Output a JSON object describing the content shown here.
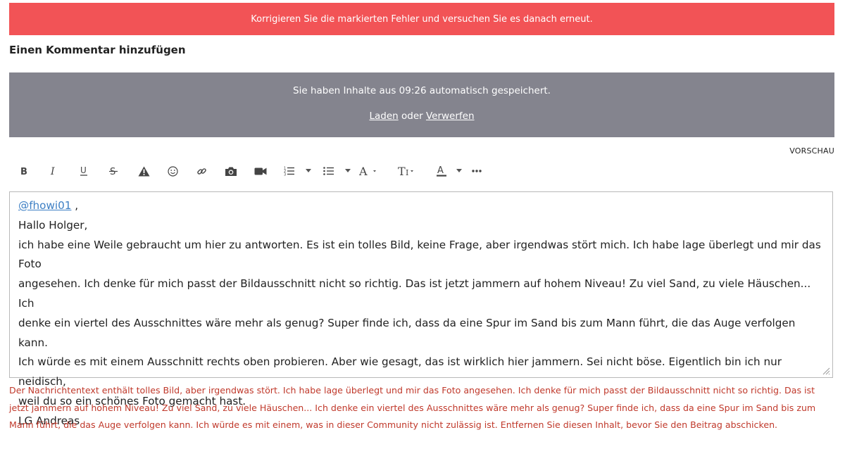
{
  "error_banner": {
    "text": "Korrigieren Sie die markierten Fehler und versuchen Sie es danach erneut."
  },
  "section_title": "Einen Kommentar hinzufügen",
  "autosave": {
    "message": "Sie haben Inhalte aus 09:26 automatisch gespeichert.",
    "load_label": "Laden",
    "or_label": "oder",
    "discard_label": "Verwerfen"
  },
  "preview_label": "VORSCHAU",
  "toolbar": {
    "icons": [
      "bold-icon",
      "italic-icon",
      "underline-icon",
      "strikethrough-icon",
      "warning-icon",
      "emoji-icon",
      "link-icon",
      "camera-icon",
      "video-icon",
      "numbered-list-icon",
      "bulleted-list-icon",
      "font-icon",
      "text-size-icon",
      "text-color-icon",
      "more-icon"
    ]
  },
  "editor": {
    "mention": "@fhowi01",
    "mention_suffix": " ,",
    "lines": [
      "Hallo Holger,",
      "ich habe eine Weile gebraucht um hier zu antworten. Es ist ein tolles Bild, keine Frage, aber irgendwas stört mich. Ich habe lage überlegt und mir das Foto",
      "angesehen. Ich denke für mich passt der Bildausschnitt nicht so richtig. Das ist jetzt jammern auf hohem Niveau! Zu viel Sand, zu viele Häuschen... Ich",
      "denke ein viertel des Ausschnittes wäre mehr als genug? Super finde ich, dass da eine Spur im Sand bis zum Mann führt, die das Auge verfolgen kann.",
      "Ich würde es mit einem Ausschnitt rechts oben probieren. Aber wie gesagt, das ist wirklich hier jammern. Sei nicht böse. Eigentlich bin ich nur neidisch,",
      "weil du so ein schönes Foto gemacht hast.",
      "LG Andreas"
    ]
  },
  "validation_error": {
    "lines": [
      "Der Nachrichtentext enthält tolles Bild, aber irgendwas stört. Ich habe lage überlegt und mir das Foto angesehen. Ich denke für mich passt der Bildausschnitt nicht so richtig. Das ist",
      "jetzt jammern auf hohem Niveau! Zu viel Sand, zu viele Häuschen... Ich denke ein viertel des Ausschnittes wäre mehr als genug? Super finde ich, dass da eine Spur im Sand bis zum",
      "Mann führt, die das Auge verfolgen kann. Ich würde es mit einem, was in dieser Community nicht zulässig ist. Entfernen Sie diesen Inhalt, bevor Sie den Beitrag abschicken."
    ]
  },
  "colors": {
    "error": "#f25356",
    "autosave_bg": "#84848e",
    "mention": "#3d7fc4",
    "error_text": "#c0392b"
  }
}
